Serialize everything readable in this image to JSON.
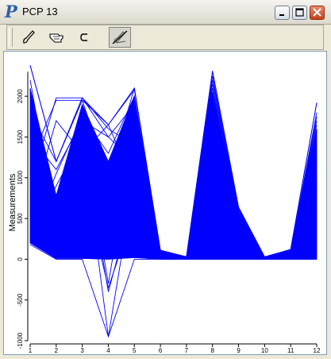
{
  "window": {
    "title": "PCP 13"
  },
  "toolbar": {
    "tools": [
      {
        "name": "brush-tool",
        "icon": "brush-icon",
        "active": false
      },
      {
        "name": "pointer-tool",
        "icon": "hand-pointer-icon",
        "active": false
      },
      {
        "name": "subset-tool",
        "icon": "subset-icon",
        "active": false
      },
      {
        "name": "brush-off-tool",
        "icon": "crossed-brush-icon",
        "active": true
      }
    ]
  },
  "colors": {
    "series": "#0000FF",
    "background": "#FFFFFF",
    "chrome": "#ECE9D8"
  },
  "chart_data": {
    "type": "line",
    "subtype": "parallel-coordinates",
    "ylabel": "Measurements",
    "xlabel": "",
    "axes": [
      "1",
      "2",
      "3",
      "4",
      "5",
      "6",
      "7",
      "8",
      "9",
      "10",
      "11",
      "12"
    ],
    "yticks": [
      -1000,
      -500,
      0,
      500,
      1000,
      1500,
      2000
    ],
    "ylim": [
      -1000,
      2450
    ],
    "grid": false,
    "legend": "none",
    "series_color": "#0000FF",
    "envelope": {
      "max": [
        2380,
        1200,
        1980,
        1650,
        2100,
        110,
        30,
        2310,
        640,
        30,
        120,
        1920
      ],
      "min": [
        180,
        0,
        0,
        -950,
        0,
        0,
        0,
        0,
        0,
        0,
        0,
        0
      ]
    },
    "dense_band": {
      "upper": [
        2100,
        780,
        1900,
        1200,
        2000,
        100,
        20,
        2050,
        560,
        20,
        100,
        1600
      ],
      "lower": [
        200,
        10,
        10,
        0,
        20,
        0,
        0,
        0,
        0,
        0,
        0,
        0
      ]
    },
    "highlighted_lines": [
      [
        2380,
        1200,
        1950,
        1650,
        2080,
        110,
        30,
        2310,
        640,
        25,
        120,
        1920
      ],
      [
        1800,
        1200,
        1980,
        1600,
        1400,
        100,
        20,
        2000,
        600,
        20,
        100,
        1700
      ],
      [
        900,
        1980,
        1980,
        1500,
        1200,
        100,
        20,
        2200,
        620,
        20,
        110,
        1500
      ],
      [
        1200,
        1950,
        1950,
        1000,
        2100,
        100,
        20,
        2250,
        600,
        20,
        100,
        1800
      ],
      [
        600,
        1700,
        1300,
        1650,
        900,
        100,
        20,
        2100,
        580,
        20,
        100,
        1400
      ],
      [
        400,
        300,
        1500,
        -950,
        1000,
        100,
        20,
        2050,
        560,
        20,
        100,
        1600
      ],
      [
        300,
        900,
        1500,
        -400,
        800,
        90,
        20,
        2000,
        540,
        20,
        90,
        1300
      ],
      [
        2200,
        400,
        1600,
        -300,
        1600,
        100,
        25,
        2150,
        600,
        20,
        100,
        1750
      ],
      [
        200,
        800,
        1000,
        -350,
        600,
        80,
        10,
        1900,
        500,
        15,
        90,
        1200
      ],
      [
        1500,
        1100,
        1700,
        1500,
        1900,
        100,
        20,
        2050,
        560,
        20,
        100,
        1650
      ],
      [
        250,
        1050,
        1750,
        1300,
        2000,
        100,
        20,
        2000,
        560,
        20,
        100,
        1550
      ]
    ]
  }
}
